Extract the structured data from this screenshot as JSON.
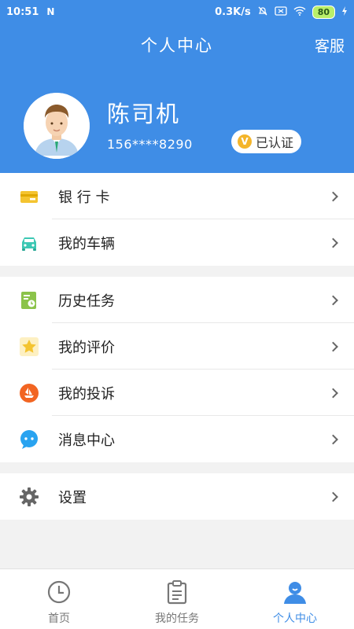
{
  "status_bar": {
    "time": "10:51",
    "network_speed": "0.3K/s",
    "battery": "80"
  },
  "header": {
    "title": "个人中心",
    "service_label": "客服"
  },
  "profile": {
    "name": "陈司机",
    "phone": "156****8290",
    "verified_label": "已认证",
    "verified_badge": "V"
  },
  "menu": {
    "group1": [
      {
        "label": "银 行 卡",
        "icon": "bank-card-icon",
        "color": "#f4c430"
      },
      {
        "label": "我的车辆",
        "icon": "car-icon",
        "color": "#3cc8b4"
      }
    ],
    "group2": [
      {
        "label": "历史任务",
        "icon": "history-task-icon",
        "color": "#8bc34a"
      },
      {
        "label": "我的评价",
        "icon": "star-icon",
        "color": "#f4c430"
      },
      {
        "label": "我的投诉",
        "icon": "complaint-icon",
        "color": "#f26522"
      },
      {
        "label": "消息中心",
        "icon": "message-icon",
        "color": "#29a3f0"
      }
    ],
    "group3": [
      {
        "label": "设置",
        "icon": "gear-icon",
        "color": "#666666"
      }
    ]
  },
  "bottom_nav": [
    {
      "label": "首页",
      "icon": "clock-icon",
      "active": false
    },
    {
      "label": "我的任务",
      "icon": "clipboard-icon",
      "active": false
    },
    {
      "label": "个人中心",
      "icon": "person-icon",
      "active": true
    }
  ],
  "colors": {
    "primary": "#3f8de6",
    "background": "#f2f2f2"
  }
}
